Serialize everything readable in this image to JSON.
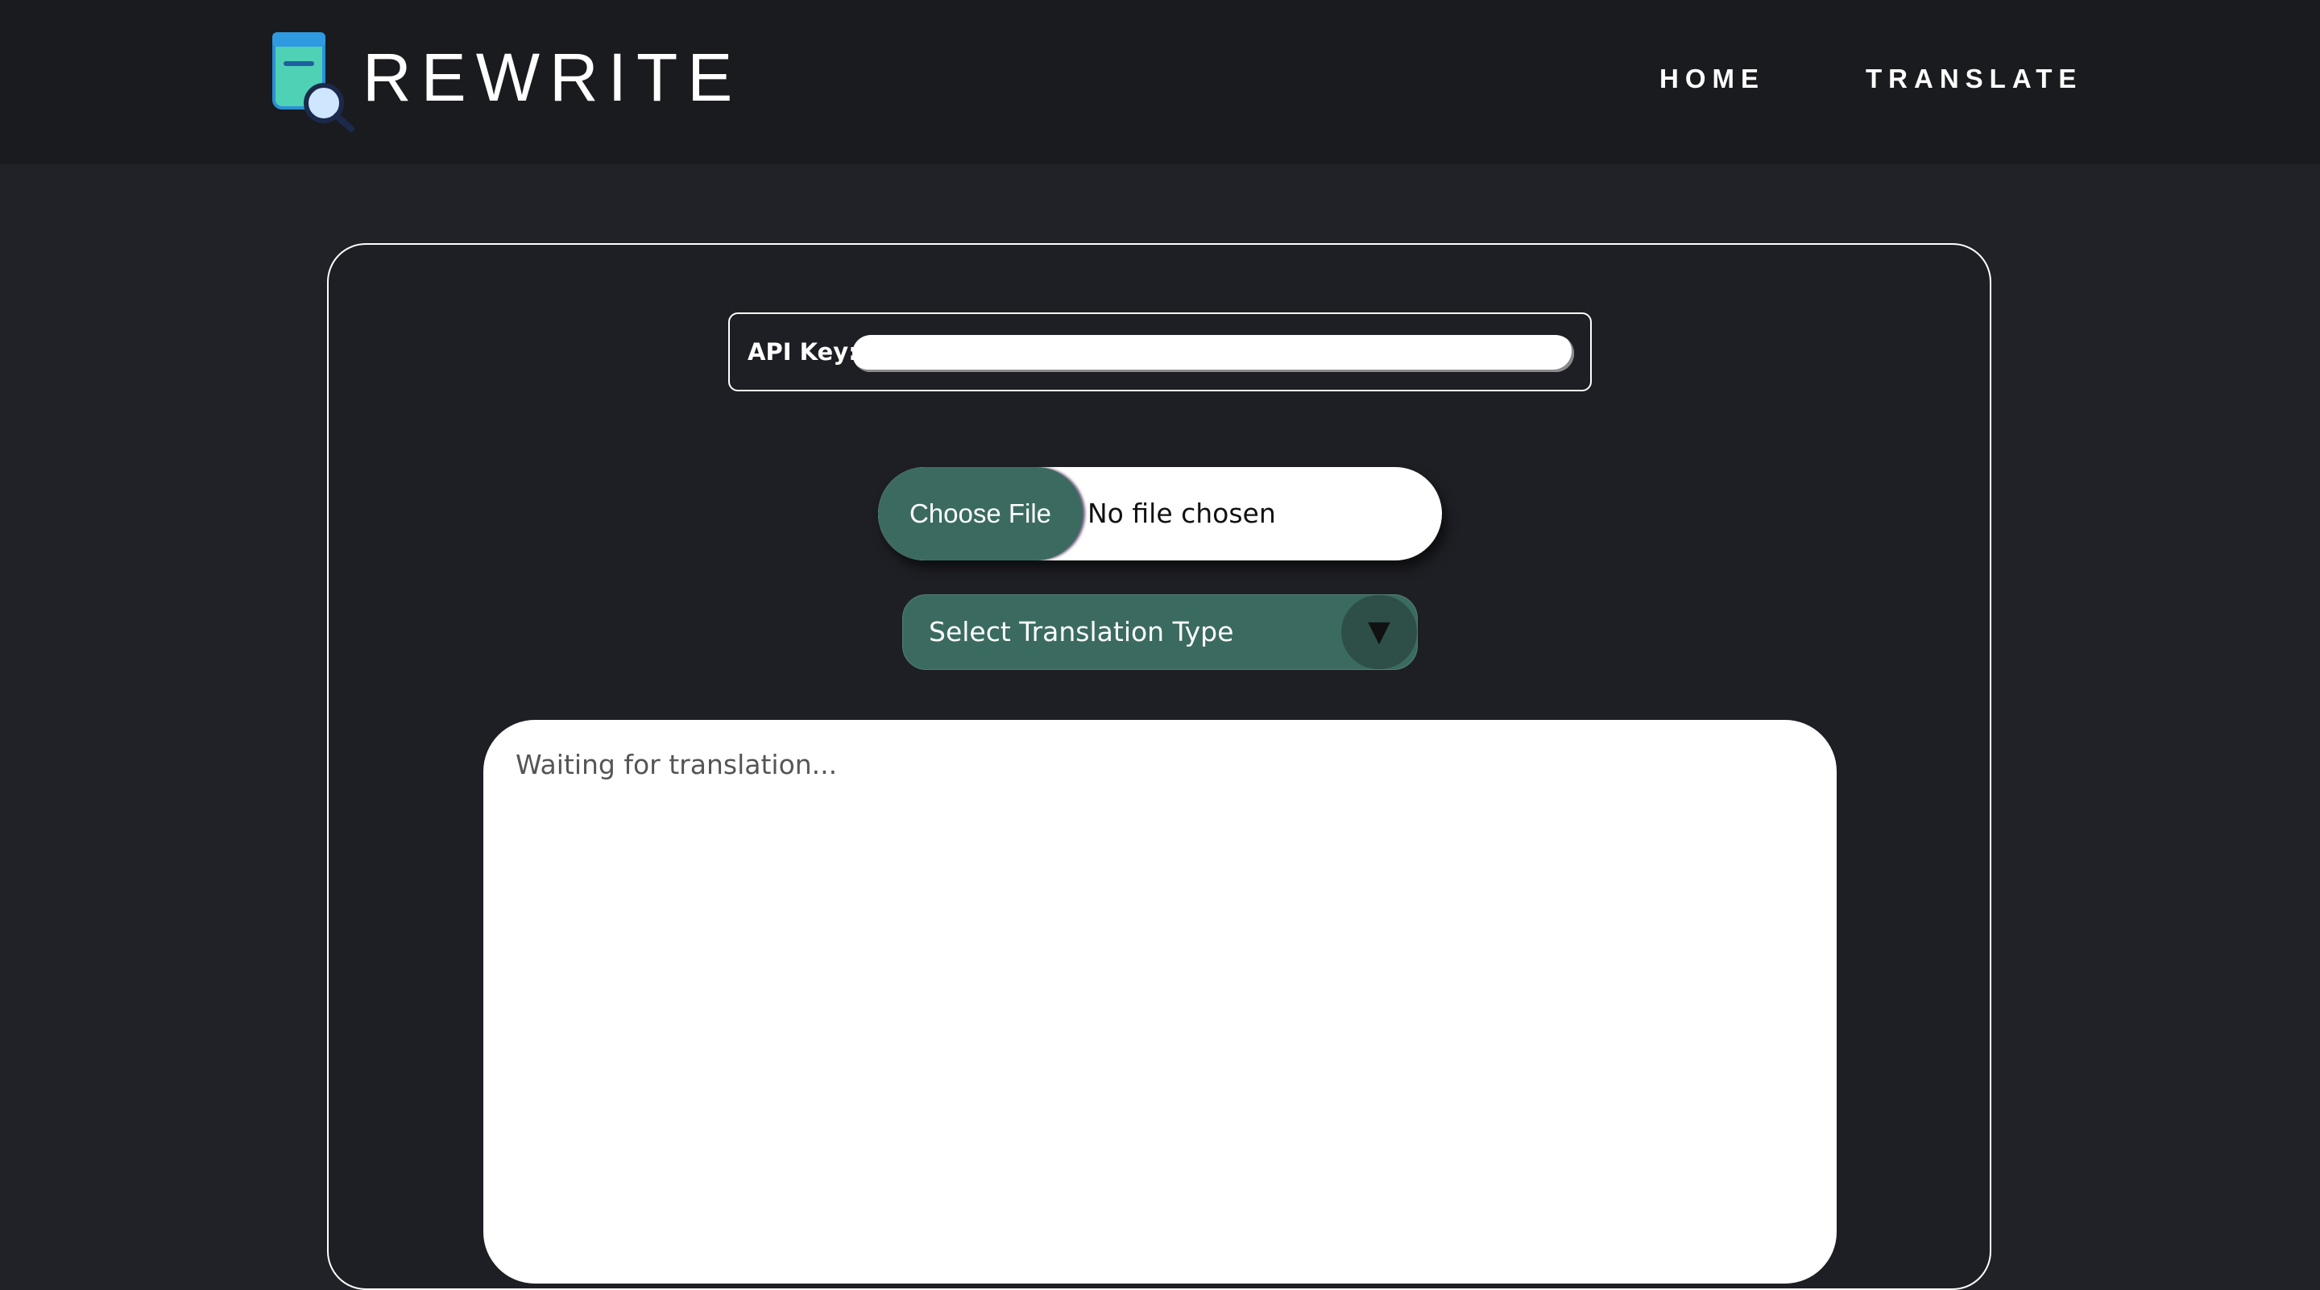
{
  "brand": {
    "name": "REWRITE",
    "logo_icon": "document-search-icon"
  },
  "nav": {
    "home": "HOME",
    "translate": "TRANSLATE"
  },
  "form": {
    "api_key_label": "API Key:",
    "api_key_value": "",
    "file_button": "Choose File",
    "file_status": "No file chosen",
    "select_label": "Select Translation Type",
    "select_arrow": "▼",
    "output_placeholder": "Waiting for translation..."
  },
  "colors": {
    "background": "#202227",
    "header": "#1a1b1f",
    "accent": "#3b6b60",
    "logo": "#6fe0c8"
  }
}
